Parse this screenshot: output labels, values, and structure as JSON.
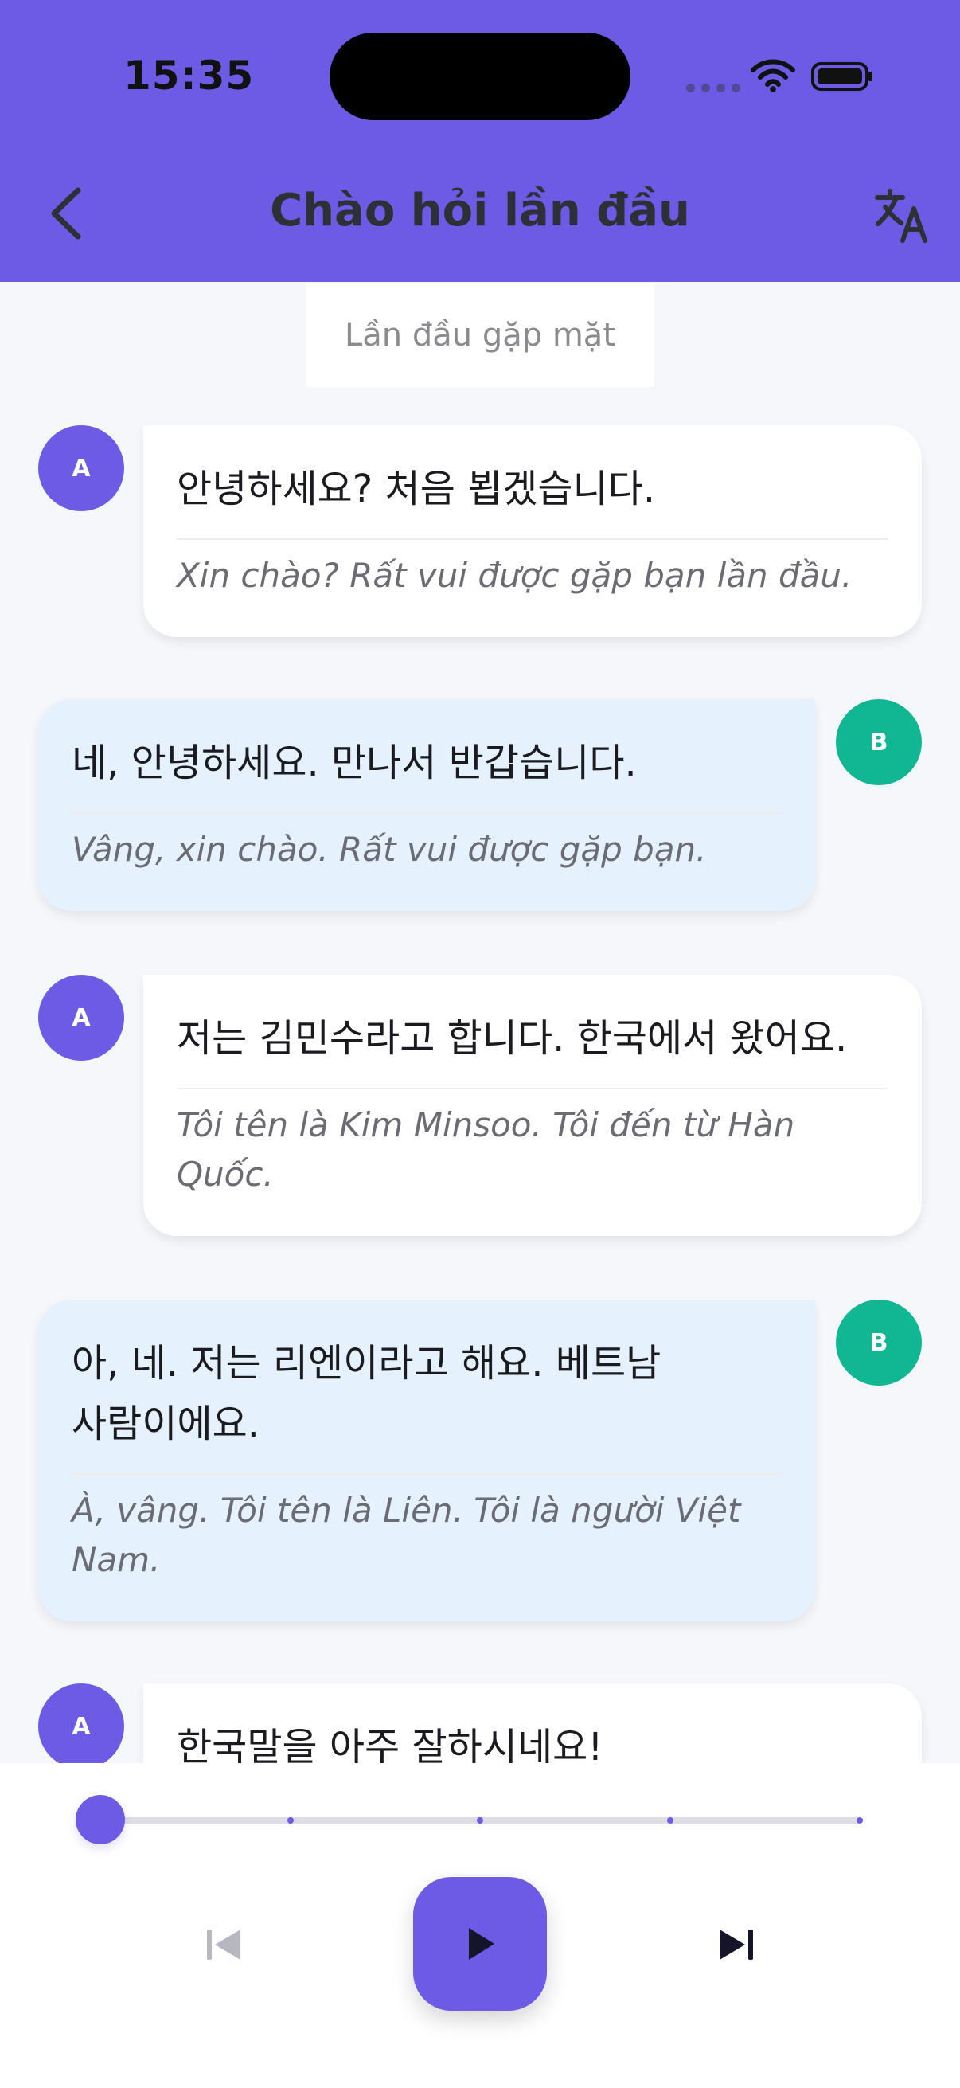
{
  "status_bar": {
    "time": "15:35",
    "signal_icon": "signal-dots-icon",
    "wifi_icon": "wifi-icon",
    "battery_icon": "battery-icon"
  },
  "header": {
    "title": "Chào hỏi lần đầu",
    "back_icon": "chevron-left-icon",
    "translate_icon": "translate-icon",
    "background": "#6d5be6"
  },
  "section": {
    "label": "Lần đầu gặp mặt"
  },
  "messages": [
    {
      "speaker": "A",
      "korean": "안녕하세요? 처음 뵙겠습니다.",
      "vietnamese": "Xin chào? Rất vui được gặp bạn lần đầu."
    },
    {
      "speaker": "B",
      "korean": "네, 안녕하세요. 만나서 반갑습니다.",
      "vietnamese": "Vâng, xin chào. Rất vui được gặp bạn."
    },
    {
      "speaker": "A",
      "korean": "저는 김민수라고 합니다. 한국에서 왔어요.",
      "vietnamese": "Tôi tên là Kim Minsoo. Tôi đến từ Hàn Quốc."
    },
    {
      "speaker": "B",
      "korean": "아, 네. 저는 리엔이라고 해요. 베트남 사람이에요.",
      "vietnamese": "À, vâng. Tôi tên là Liên. Tôi là người Việt Nam."
    },
    {
      "speaker": "A",
      "korean": "한국말을 아주 잘하시네요!",
      "vietnamese": ""
    }
  ],
  "player": {
    "progress": 0,
    "markers": 5,
    "prev_icon": "skip-previous-icon",
    "play_icon": "play-icon",
    "next_icon": "skip-next-icon",
    "accent": "#6d5be6"
  }
}
